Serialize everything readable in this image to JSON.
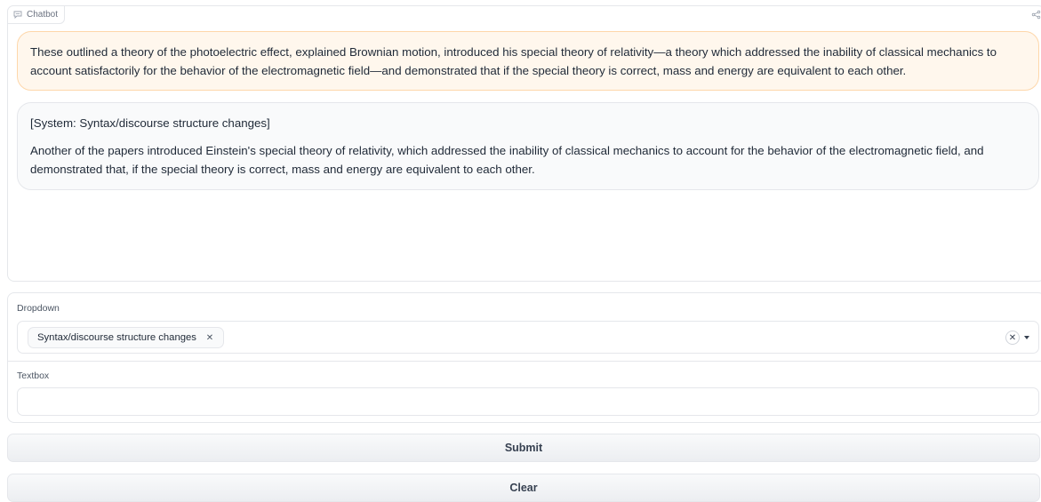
{
  "chatbot": {
    "label": "Chatbot",
    "messages": [
      {
        "role": "user",
        "text": "These outlined a theory of the photoelectric effect, explained Brownian motion, introduced his special theory of relativity—a theory which addressed the inability of classical mechanics to account satisfactorily for the behavior of the electromagnetic field—and demonstrated that if the special theory is correct, mass and energy are equivalent to each other."
      },
      {
        "role": "bot",
        "system_line": "[System: Syntax/discourse structure changes]",
        "text": "Another of the papers introduced Einstein's special theory of relativity, which addressed the inability of classical mechanics to account for the behavior of the electromagnetic field, and demonstrated that, if the special theory is correct, mass and energy are equivalent to each other."
      }
    ]
  },
  "dropdown": {
    "label": "Dropdown",
    "selected": [
      "Syntax/discourse structure changes"
    ]
  },
  "textbox": {
    "label": "Textbox",
    "value": ""
  },
  "buttons": {
    "submit": "Submit",
    "clear": "Clear"
  },
  "icons": {
    "chat": "chat-icon",
    "share": "share-icon",
    "chip_remove": "close-icon",
    "clear_all": "close-icon",
    "caret": "chevron-down-icon"
  },
  "colors": {
    "user_bubble_bg": "#fff7ed",
    "user_bubble_border": "#fed7aa",
    "bot_bubble_bg": "#f9fafb",
    "border": "#e5e7eb"
  }
}
